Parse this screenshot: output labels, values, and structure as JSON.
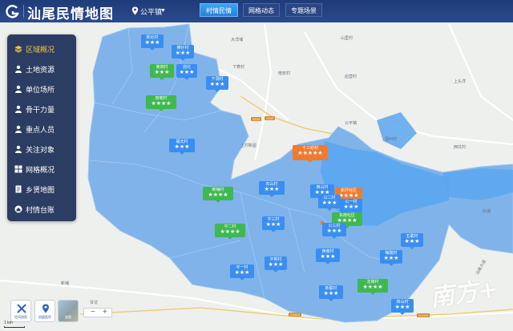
{
  "header": {
    "app_title": "汕尾民情地图",
    "town": "公平镇",
    "tabs": [
      {
        "label": "村情民情",
        "active": true
      },
      {
        "label": "网格动态",
        "active": false
      },
      {
        "label": "专题场景",
        "active": false
      }
    ],
    "colors": {
      "bar": "#2b4a8e",
      "active_tab": "#3ea4f5"
    }
  },
  "sidebar": {
    "items": [
      {
        "label": "区域概况",
        "icon": "layers-icon",
        "active": true
      },
      {
        "label": "土地资源",
        "icon": "user-icon",
        "active": false
      },
      {
        "label": "单位场所",
        "icon": "user-icon",
        "active": false
      },
      {
        "label": "骨干力量",
        "icon": "user-icon",
        "active": false
      },
      {
        "label": "重点人员",
        "icon": "user-icon",
        "active": false
      },
      {
        "label": "关注对象",
        "icon": "user-icon",
        "active": false
      },
      {
        "label": "网格概况",
        "icon": "grid-icon",
        "active": false
      },
      {
        "label": "乡贤地图",
        "icon": "document-icon",
        "active": false
      },
      {
        "label": "村情台账",
        "icon": "home-icon",
        "active": false
      }
    ]
  },
  "map": {
    "colors": {
      "region": "#7fb3ea",
      "water": "#5aa6ef",
      "land": "#eef0ed"
    },
    "road_tags": [
      "S242",
      "S242",
      "G1523",
      "G1523"
    ],
    "places": [
      "大洋埔",
      "下寮村",
      "南安村",
      "山里村",
      "上头洋",
      "公平镇",
      "上村新屋",
      "后营村",
      "新埔",
      "甘坑",
      "福州村",
      "西坑村",
      "红湖",
      "汕尾大道"
    ],
    "markers": [
      {
        "name": "新社村",
        "stars": "★★★",
        "color": "blue"
      },
      {
        "name": "横仔村",
        "stars": "★★★",
        "color": "blue"
      },
      {
        "name": "南田村",
        "stars": "★★★",
        "color": "green"
      },
      {
        "name": "迎北",
        "stars": "★★★",
        "color": "blue"
      },
      {
        "name": "下洞村",
        "stars": "★★★",
        "color": "blue"
      },
      {
        "name": "田墘村",
        "stars": "★★★★",
        "color": "green"
      },
      {
        "name": "福北村",
        "stars": "★★★",
        "color": "blue"
      },
      {
        "name": "十三纺村",
        "stars": "★★★★★",
        "color": "orange"
      },
      {
        "name": "新铺村",
        "stars": "★★★★",
        "color": "green"
      },
      {
        "name": "石山村",
        "stars": "★★★",
        "color": "blue"
      },
      {
        "name": "西山村",
        "stars": "★★★",
        "color": "blue"
      },
      {
        "name": "新圩社区",
        "stars": "★★★★",
        "color": "orange"
      },
      {
        "name": "公二村",
        "stars": "★★★",
        "color": "blue"
      },
      {
        "name": "公一村",
        "stars": "★★★",
        "color": "blue"
      },
      {
        "name": "东南社区",
        "stars": "★★★★",
        "color": "green"
      },
      {
        "name": "平三村",
        "stars": "★★★",
        "color": "blue"
      },
      {
        "name": "公三村",
        "stars": "★★★",
        "color": "blue"
      },
      {
        "name": "平二村",
        "stars": "★★★★",
        "color": "green"
      },
      {
        "name": "五联村",
        "stars": "★★★",
        "color": "blue"
      },
      {
        "name": "平一村",
        "stars": "★★★",
        "color": "blue"
      },
      {
        "name": "平新村",
        "stars": "★★★",
        "color": "blue"
      },
      {
        "name": "西南村",
        "stars": "★★★",
        "color": "blue"
      },
      {
        "name": "梅陇村",
        "stars": "★★★",
        "color": "blue"
      },
      {
        "name": "新联村",
        "stars": "★★★",
        "color": "blue"
      },
      {
        "name": "龙岗村",
        "stars": "★★★★",
        "color": "green"
      },
      {
        "name": "四山村",
        "stars": "★★★",
        "color": "blue"
      }
    ]
  },
  "controls": {
    "tool1": "空间测距",
    "tool2": "测量面积",
    "tool3": "底图",
    "zoom_out": "−",
    "zoom_in": "+",
    "scale": "1 km"
  },
  "watermark": "南方+"
}
